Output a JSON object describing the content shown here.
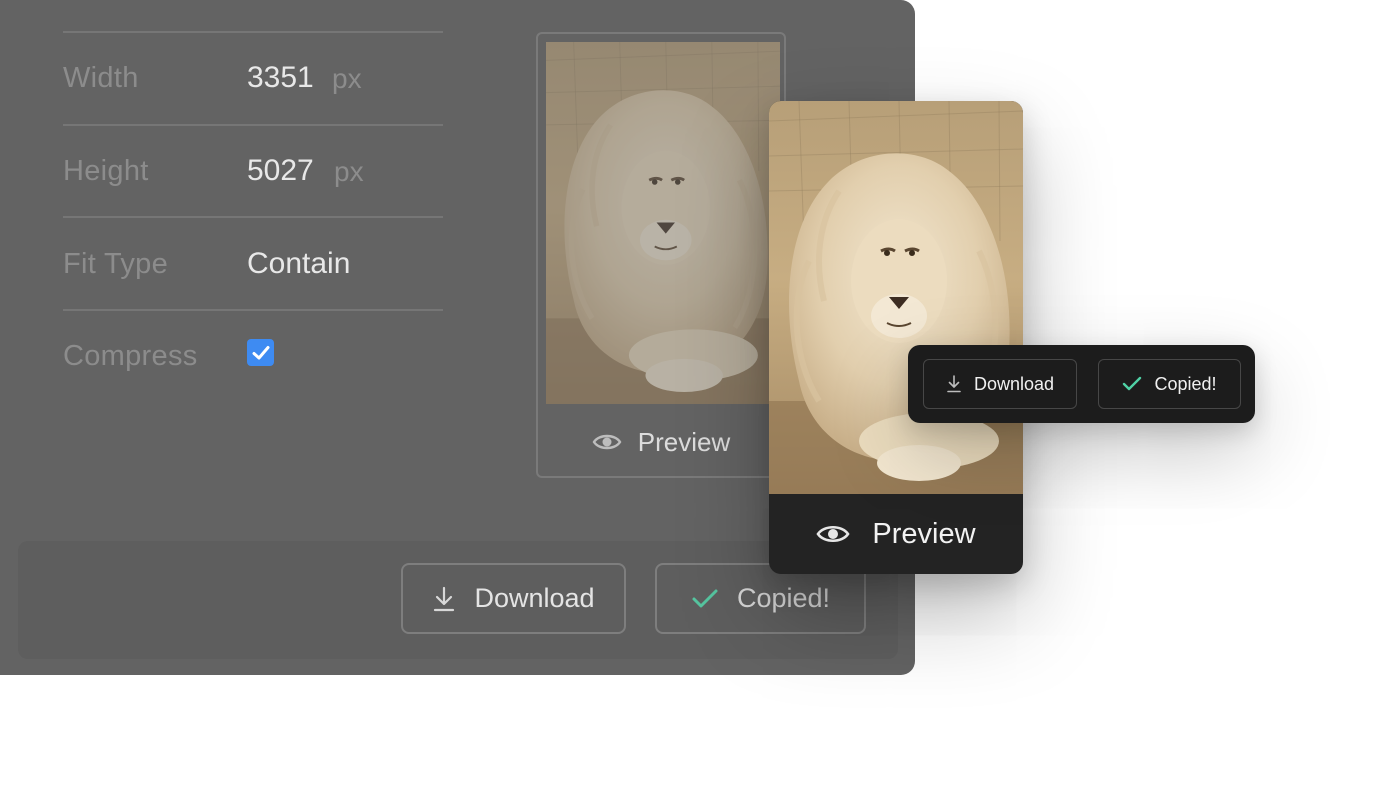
{
  "settings": {
    "width": {
      "label": "Width",
      "value": "3351",
      "unit": "px"
    },
    "height": {
      "label": "Height",
      "value": "5027",
      "unit": "px"
    },
    "fit_type": {
      "label": "Fit Type",
      "value": "Contain"
    },
    "compress": {
      "label": "Compress",
      "checked": true
    }
  },
  "thumbnail": {
    "preview_label": "Preview"
  },
  "actions": {
    "download_label": "Download",
    "copied_label": "Copied!"
  },
  "floating_card": {
    "preview_label": "Preview"
  },
  "toolbar": {
    "download_label": "Download",
    "copied_label": "Copied!"
  },
  "colors": {
    "panel": "#636363",
    "checkbox": "#3e8bf2",
    "check_accent": "#4fd1a5",
    "card_dark": "#232323",
    "toolbar_dark": "#1c1c1c"
  },
  "icons": [
    "download-icon",
    "check-icon",
    "eye-icon",
    "checkbox-check-icon"
  ]
}
